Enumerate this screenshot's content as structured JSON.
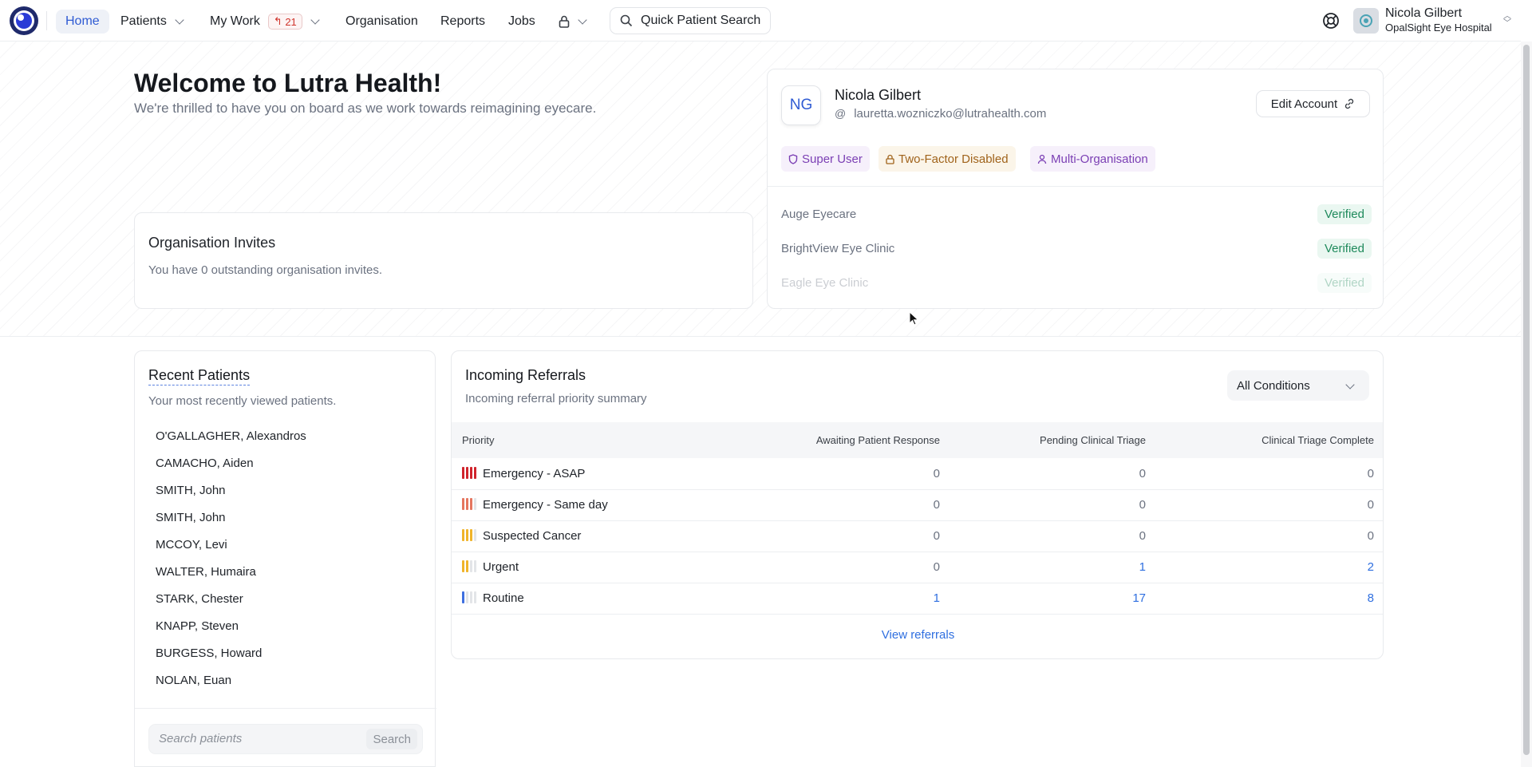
{
  "nav": {
    "items": [
      {
        "label": "Home",
        "active": true
      },
      {
        "label": "Patients"
      },
      {
        "label": "My Work",
        "badge": "21"
      },
      {
        "label": "Organisation"
      },
      {
        "label": "Reports"
      },
      {
        "label": "Jobs"
      }
    ],
    "quick_search_label": "Quick Patient Search",
    "user": {
      "name": "Nicola Gilbert",
      "org": "OpalSight Eye Hospital"
    }
  },
  "hero": {
    "title": "Welcome to Lutra Health!",
    "subtitle": "We're thrilled to have you on board as we work towards reimagining eyecare."
  },
  "invites": {
    "title": "Organisation Invites",
    "text": "You have 0 outstanding organisation invites."
  },
  "account": {
    "initials": "NG",
    "name": "Nicola Gilbert",
    "email": "lauretta.wozniczko@lutrahealth.com",
    "edit_label": "Edit Account",
    "tags": [
      "Super User",
      "Two-Factor Disabled",
      "Multi-Organisation"
    ],
    "orgs": [
      {
        "name": "Auge Eyecare",
        "status": "Verified"
      },
      {
        "name": "BrightView Eye Clinic",
        "status": "Verified"
      },
      {
        "name": "Eagle Eye Clinic",
        "status": "Verified"
      }
    ]
  },
  "recent": {
    "title": "Recent Patients",
    "subtitle": "Your most recently viewed patients.",
    "patients": [
      "O'GALLAGHER, Alexandros",
      "CAMACHO, Aiden",
      "SMITH, John",
      "SMITH, John",
      "MCCOY, Levi",
      "WALTER, Humaira",
      "STARK, Chester",
      "KNAPP, Steven",
      "BURGESS, Howard",
      "NOLAN, Euan"
    ],
    "search_placeholder": "Search patients",
    "search_button": "Search"
  },
  "referrals": {
    "title": "Incoming Referrals",
    "subtitle": "Incoming referral priority summary",
    "filter_value": "All Conditions",
    "columns": [
      "Priority",
      "Awaiting Patient Response",
      "Pending Clinical Triage",
      "Clinical Triage Complete"
    ],
    "rows": [
      {
        "priority": "Emergency - ASAP",
        "level": 4,
        "color": "#d0242c",
        "values": [
          "0",
          "0",
          "0"
        ]
      },
      {
        "priority": "Emergency - Same day",
        "level": 3,
        "color": "#e5765f",
        "values": [
          "0",
          "0",
          "0"
        ]
      },
      {
        "priority": "Suspected Cancer",
        "level": 3,
        "color": "#f0b42a",
        "values": [
          "0",
          "0",
          "0"
        ]
      },
      {
        "priority": "Urgent",
        "level": 2,
        "color": "#f0b42a",
        "values": [
          "0",
          "1",
          "2"
        ]
      },
      {
        "priority": "Routine",
        "level": 1,
        "color": "#3e6fe0",
        "values": [
          "1",
          "17",
          "8"
        ]
      }
    ],
    "view_label": "View referrals"
  }
}
